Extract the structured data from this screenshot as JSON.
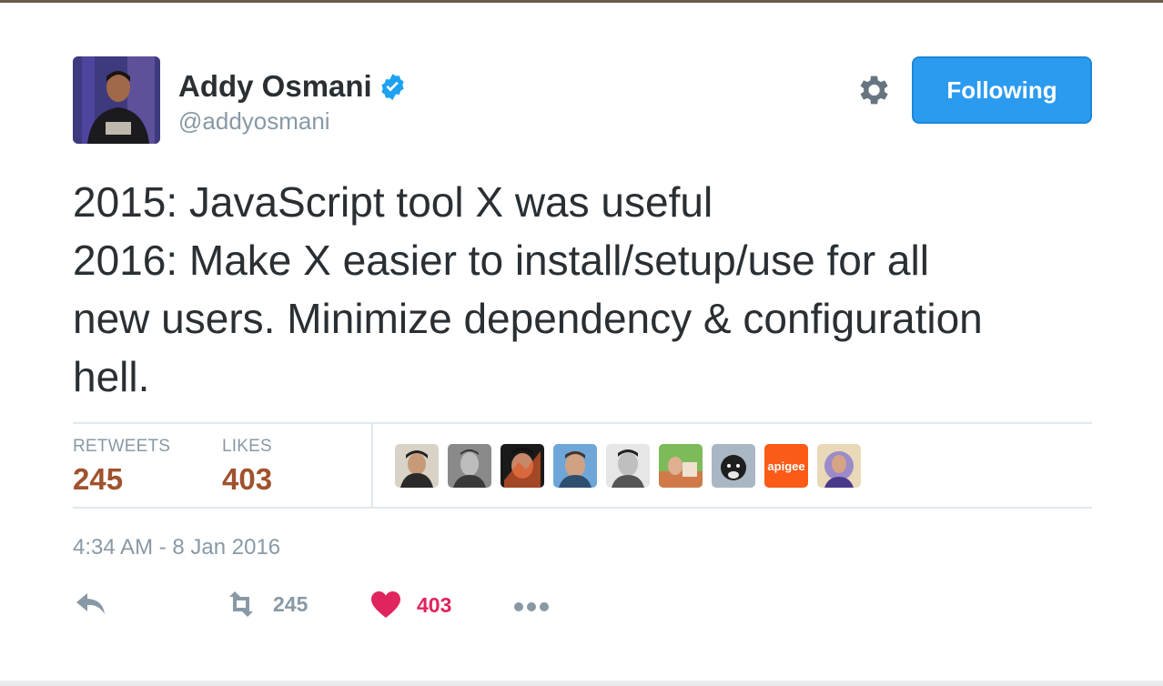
{
  "author": {
    "name": "Addy Osmani",
    "handle": "@addyosmani"
  },
  "follow_button": {
    "label": "Following"
  },
  "tweet": {
    "lines": [
      "2015: JavaScript tool X was useful",
      "2016: Make X easier to install/setup/use for all",
      "new users. Minimize dependency & configuration",
      "hell."
    ]
  },
  "stats": {
    "retweets_label": "RETWEETS",
    "retweets_value": "245",
    "likes_label": "LIKES",
    "likes_value": "403"
  },
  "likers": [
    {
      "name": "liker-avatar-1"
    },
    {
      "name": "liker-avatar-2"
    },
    {
      "name": "liker-avatar-3"
    },
    {
      "name": "liker-avatar-4"
    },
    {
      "name": "liker-avatar-5"
    },
    {
      "name": "liker-avatar-6"
    },
    {
      "name": "liker-avatar-7"
    },
    {
      "name": "liker-avatar-apigee",
      "text": "apigee"
    },
    {
      "name": "liker-avatar-9"
    }
  ],
  "timestamp": "4:34 AM - 8 Jan 2016",
  "actions": {
    "retweet_count": "245",
    "like_count": "403"
  },
  "colors": {
    "accent_blue": "#2b9bf0",
    "stat_value": "#a0522d",
    "like_red": "#e0245e",
    "muted": "#8899a6"
  },
  "icons": [
    "verified-badge-icon",
    "gear-icon",
    "reply-icon",
    "retweet-icon",
    "heart-icon",
    "more-icon"
  ]
}
